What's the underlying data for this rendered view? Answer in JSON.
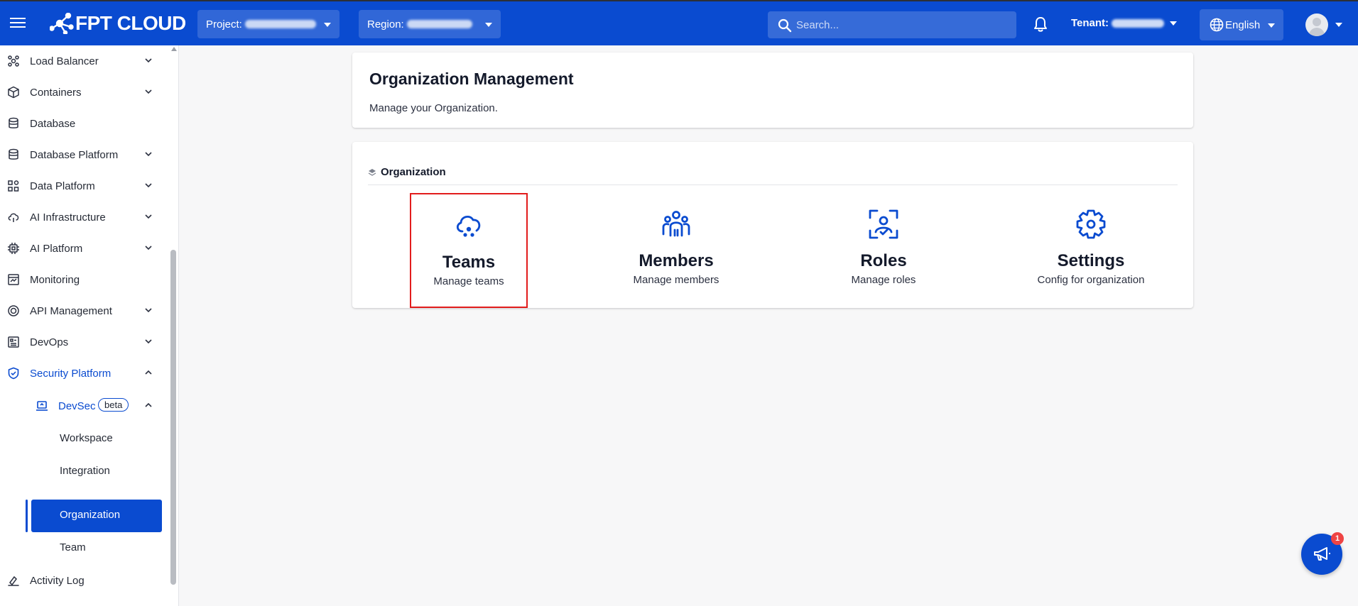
{
  "topbar": {
    "brand": "FPT CLOUD",
    "project_label": "Project:",
    "region_label": "Region:",
    "search_placeholder": "Search...",
    "tenant_label": "Tenant:",
    "language": "English",
    "accent": "#0a4bd0"
  },
  "sidebar": {
    "items": [
      {
        "label": "Load Balancer",
        "icon": "load-balancer-icon",
        "expandable": true
      },
      {
        "label": "Containers",
        "icon": "cube-icon",
        "expandable": true
      },
      {
        "label": "Database",
        "icon": "database-icon",
        "expandable": false
      },
      {
        "label": "Database Platform",
        "icon": "database-platform-icon",
        "expandable": true
      },
      {
        "label": "Data Platform",
        "icon": "data-platform-icon",
        "expandable": true
      },
      {
        "label": "AI Infrastructure",
        "icon": "ai-infrastructure-icon",
        "expandable": true
      },
      {
        "label": "AI Platform",
        "icon": "chip-icon",
        "expandable": true
      },
      {
        "label": "Monitoring",
        "icon": "monitor-icon",
        "expandable": false
      },
      {
        "label": "API Management",
        "icon": "api-icon",
        "expandable": true
      },
      {
        "label": "DevOps",
        "icon": "devops-icon",
        "expandable": true
      },
      {
        "label": "Security Platform",
        "icon": "shield-icon",
        "expandable": true,
        "expanded": true
      }
    ],
    "devsec": {
      "label": "DevSec",
      "badge": "beta"
    },
    "devsec_children": [
      {
        "label": "Workspace"
      },
      {
        "label": "Integration"
      },
      {
        "label": "Organization",
        "selected": true
      },
      {
        "label": "Team"
      }
    ],
    "activity_log": "Activity Log"
  },
  "main": {
    "title": "Organization Management",
    "description": "Manage your Organization.",
    "section_title": "Organization",
    "tiles": [
      {
        "title": "Teams",
        "subtitle": "Manage teams",
        "icon": "teams-cloud-icon"
      },
      {
        "title": "Members",
        "subtitle": "Manage members",
        "icon": "members-icon"
      },
      {
        "title": "Roles",
        "subtitle": "Manage roles",
        "icon": "roles-icon"
      },
      {
        "title": "Settings",
        "subtitle": "Config for organization",
        "icon": "settings-gear-icon"
      }
    ]
  },
  "fab": {
    "icon": "megaphone-icon",
    "count": "1"
  }
}
